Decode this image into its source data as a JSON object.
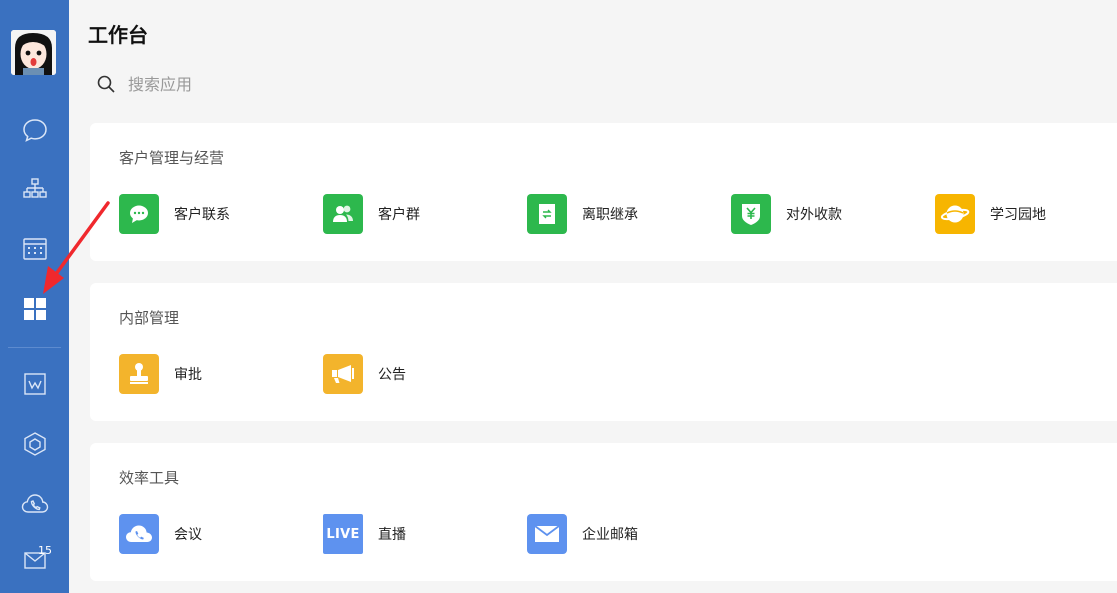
{
  "page": {
    "title": "工作台"
  },
  "search": {
    "placeholder": "搜索应用"
  },
  "sidebar": {
    "mail_badge": "15"
  },
  "sections": [
    {
      "title": "客户管理与经营",
      "apps": [
        {
          "label": "客户联系",
          "icon": "chat-bubble-icon",
          "color": "#2db84d"
        },
        {
          "label": "客户群",
          "icon": "group-icon",
          "color": "#2db84d"
        },
        {
          "label": "离职继承",
          "icon": "transfer-doc-icon",
          "color": "#2db84d"
        },
        {
          "label": "对外收款",
          "icon": "yuan-shield-icon",
          "color": "#2db84d"
        },
        {
          "label": "学习园地",
          "icon": "planet-icon",
          "color": "#f7b500"
        }
      ]
    },
    {
      "title": "内部管理",
      "apps": [
        {
          "label": "审批",
          "icon": "stamp-icon",
          "color": "#f3b42c"
        },
        {
          "label": "公告",
          "icon": "megaphone-icon",
          "color": "#f3b42c"
        }
      ]
    },
    {
      "title": "效率工具",
      "apps": [
        {
          "label": "会议",
          "icon": "cloud-phone-icon",
          "color": "#5e92ef"
        },
        {
          "label": "直播",
          "icon": "live-icon",
          "color": "#5e92ef",
          "icon_text": "LIVE"
        },
        {
          "label": "企业邮箱",
          "icon": "mail-icon",
          "color": "#5e92ef"
        }
      ]
    }
  ]
}
